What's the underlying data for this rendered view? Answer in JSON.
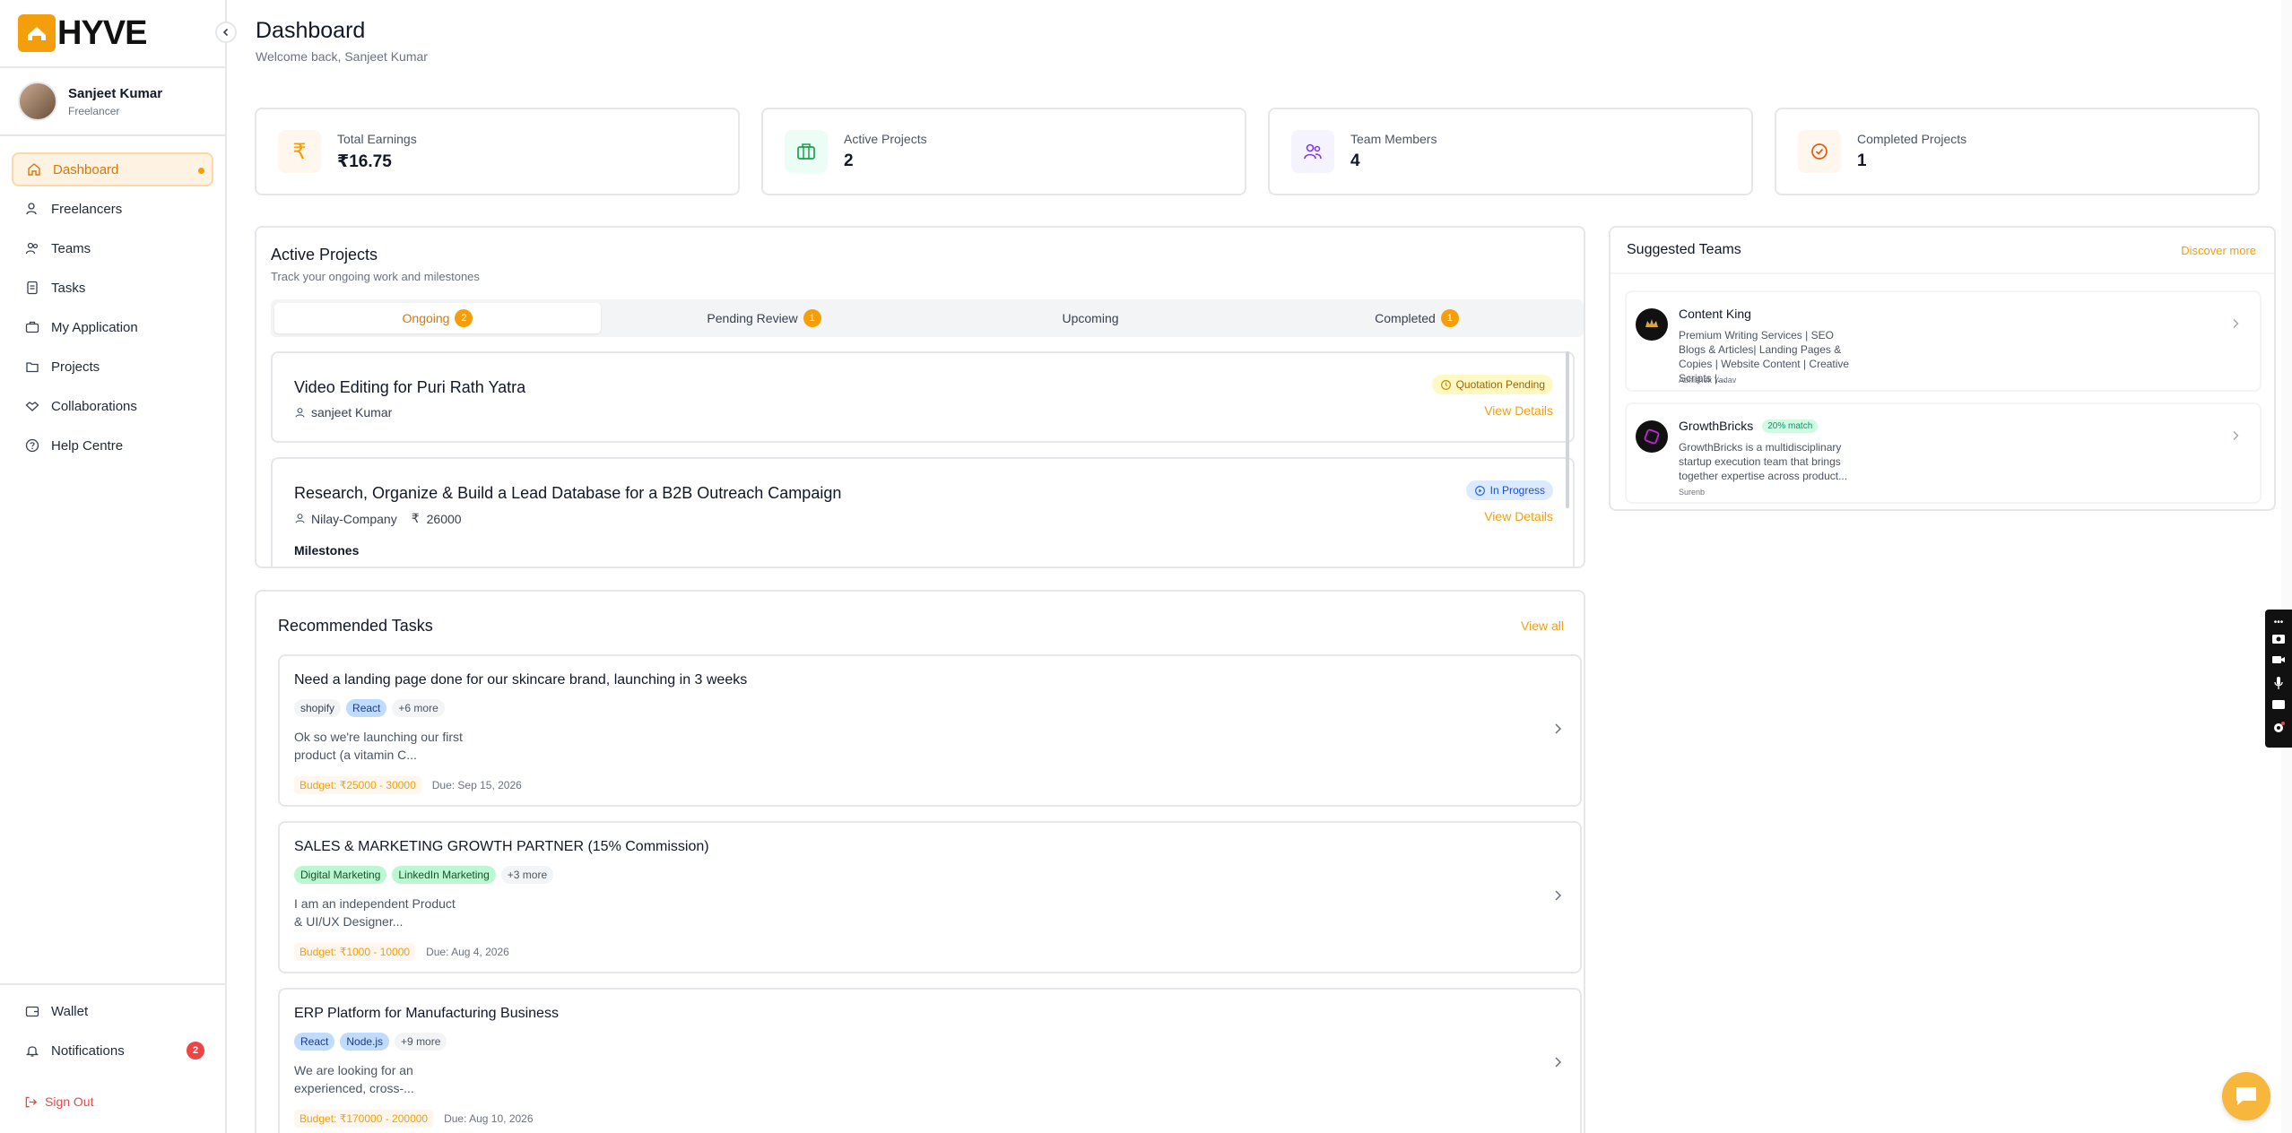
{
  "brand": {
    "name": "HYVE",
    "accent": "#f59e0b"
  },
  "user": {
    "name": "Sanjeet Kumar",
    "role": "Freelancer"
  },
  "nav": {
    "items": [
      {
        "label": "Dashboard",
        "icon": "home-icon"
      },
      {
        "label": "Freelancers",
        "icon": "user-icon"
      },
      {
        "label": "Teams",
        "icon": "users-icon"
      },
      {
        "label": "Tasks",
        "icon": "document-icon"
      },
      {
        "label": "My Application",
        "icon": "briefcase-icon"
      },
      {
        "label": "Projects",
        "icon": "folders-icon"
      },
      {
        "label": "Collaborations",
        "icon": "handshake-icon"
      },
      {
        "label": "Help Centre",
        "icon": "help-icon"
      }
    ],
    "bottom": {
      "wallet": "Wallet",
      "notifications": "Notifications",
      "notifications_count": "2",
      "signout": "Sign Out"
    }
  },
  "header": {
    "title": "Dashboard",
    "subtitle": "Welcome back, Sanjeet Kumar"
  },
  "stats": [
    {
      "label": "Total Earnings",
      "value": "₹16.75",
      "icon": "rupee-icon"
    },
    {
      "label": "Active Projects",
      "value": "2",
      "icon": "briefcase-icon"
    },
    {
      "label": "Team Members",
      "value": "4",
      "icon": "users-icon"
    },
    {
      "label": "Completed Projects",
      "value": "1",
      "icon": "check-circle-icon"
    }
  ],
  "active_projects": {
    "title": "Active Projects",
    "subtitle": "Track your ongoing work and milestones",
    "tabs": [
      {
        "label": "Ongoing",
        "count": "2"
      },
      {
        "label": "Pending Review",
        "count": "1"
      },
      {
        "label": "Upcoming",
        "count": ""
      },
      {
        "label": "Completed",
        "count": "1"
      }
    ],
    "projects": [
      {
        "title": "Video Editing for Puri Rath Yatra",
        "client": "sanjeet Kumar",
        "amount": "",
        "status": "Quotation Pending",
        "action": "View Details"
      },
      {
        "title": "Research, Organize & Build a Lead Database for a B2B Outreach Campaign",
        "client": "Nilay-Company",
        "amount": "26000",
        "status": "In Progress",
        "action": "View Details",
        "milestones_label": "Milestones"
      }
    ]
  },
  "suggested_teams": {
    "title": "Suggested Teams",
    "action": "Discover more",
    "teams": [
      {
        "name": "Content King",
        "match": "",
        "desc": "Premium Writing Services | SEO Blogs & Articles| Landing Pages & Copies | Website Content | Creative Scripts |...",
        "owner": "Abhishek Yadav"
      },
      {
        "name": "GrowthBricks",
        "match": "20% match",
        "desc": "GrowthBricks is a multidisciplinary startup execution team that brings together expertise across product...",
        "owner": "Surenb"
      }
    ]
  },
  "recommended_tasks": {
    "title": "Recommended Tasks",
    "action": "View all",
    "tasks": [
      {
        "title": "Need a landing page done for our skincare brand, launching in 3 weeks",
        "tags": [
          "shopify",
          "React",
          "+6 more"
        ],
        "desc": "Ok so we're launching our first product (a vitamin C...",
        "budget": "Budget: ₹25000 - 30000",
        "due": "Due: Sep 15, 2026"
      },
      {
        "title": "SALES & MARKETING GROWTH PARTNER (15% Commission)",
        "tags": [
          "Digital Marketing",
          "LinkedIn Marketing",
          "+3 more"
        ],
        "desc": "I am an independent Product & UI/UX Designer...",
        "budget": "Budget: ₹1000 - 10000",
        "due": "Due: Aug 4, 2026"
      },
      {
        "title": "ERP Platform for Manufacturing Business",
        "tags": [
          "React",
          "Node.js",
          "+9 more"
        ],
        "desc": "We are looking for an experienced, cross-...",
        "budget": "Budget: ₹170000 - 200000",
        "due": "Due: Aug 10, 2026"
      }
    ]
  }
}
